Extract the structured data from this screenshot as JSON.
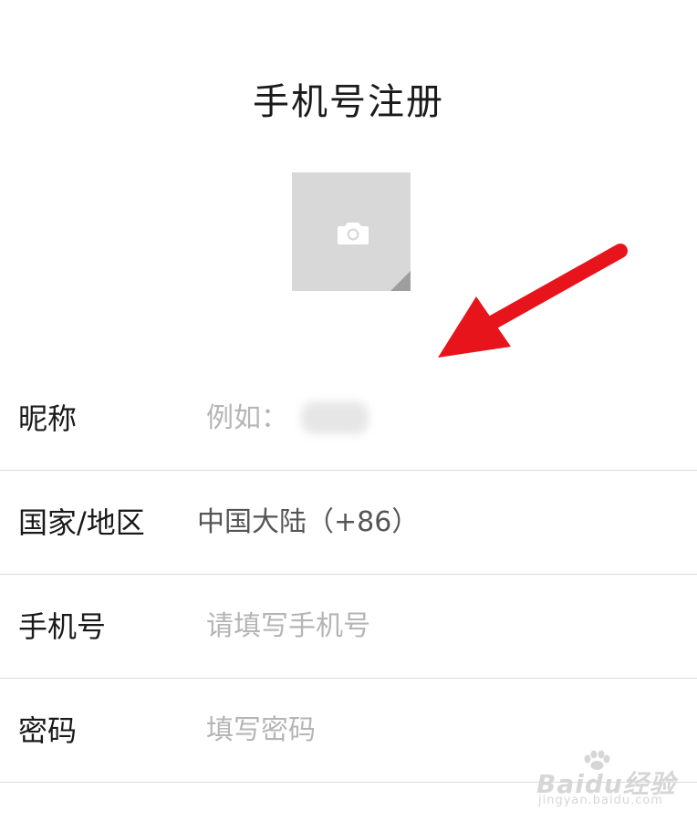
{
  "header": {
    "title": "手机号注册"
  },
  "avatar": {
    "icon": "camera-icon"
  },
  "form": {
    "nickname": {
      "label": "昵称",
      "placeholder": "例如："
    },
    "region": {
      "label": "国家/地区",
      "value": "中国大陆（+86）"
    },
    "phone": {
      "label": "手机号",
      "placeholder": "请填写手机号"
    },
    "password": {
      "label": "密码",
      "placeholder": "填写密码"
    }
  },
  "watermark": {
    "brand": "Baidu经验",
    "domain": "jingyan.baidu.com"
  },
  "colors": {
    "arrow": "#e8141c",
    "avatar_bg": "#d8d8d8",
    "placeholder": "#b5b5b5",
    "divider": "#dcdcdc"
  }
}
